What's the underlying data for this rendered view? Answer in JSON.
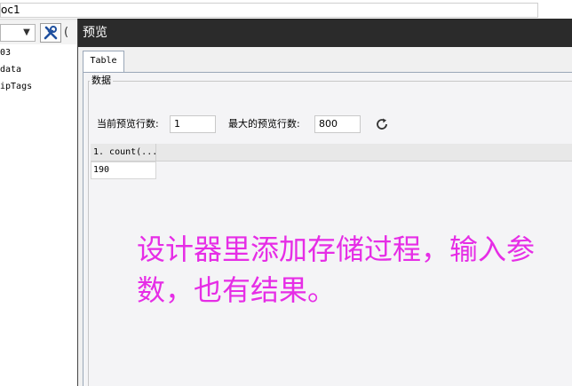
{
  "background_app": {
    "title": "oc1",
    "tree_items": [
      "03",
      "data",
      "ipTags"
    ]
  },
  "dialog": {
    "title": "预览",
    "tabs": [
      {
        "label": "Table"
      }
    ],
    "group_label": "数据",
    "current_rows_label": "当前预览行数:",
    "current_rows_value": "1",
    "max_rows_label": "最大的预览行数:",
    "max_rows_value": "800",
    "grid": {
      "columns": [
        "1. count(..."
      ],
      "rows": [
        [
          "190"
        ]
      ]
    }
  },
  "annotation": {
    "text": "设计器里添加存储过程，输入参数，也有结果。",
    "color": "#e62de6"
  },
  "colors": {
    "dialog_titlebar": "#2b2b2b",
    "annotation": "#e62de6"
  }
}
